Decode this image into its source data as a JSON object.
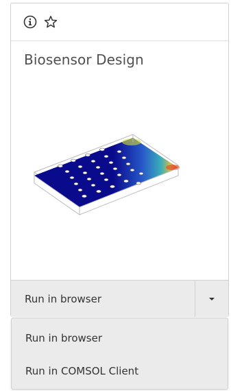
{
  "card": {
    "title": "Biosensor Design",
    "icons": [
      "info-icon",
      "star-icon"
    ],
    "run_label": "Run in browser"
  },
  "dropdown": {
    "options": [
      "Run in browser",
      "Run in COMSOL Client"
    ]
  },
  "colors": {
    "model_blue": "#0a0a8c",
    "hot_red": "#d82a1a",
    "hot_yellow": "#f0d23a"
  }
}
